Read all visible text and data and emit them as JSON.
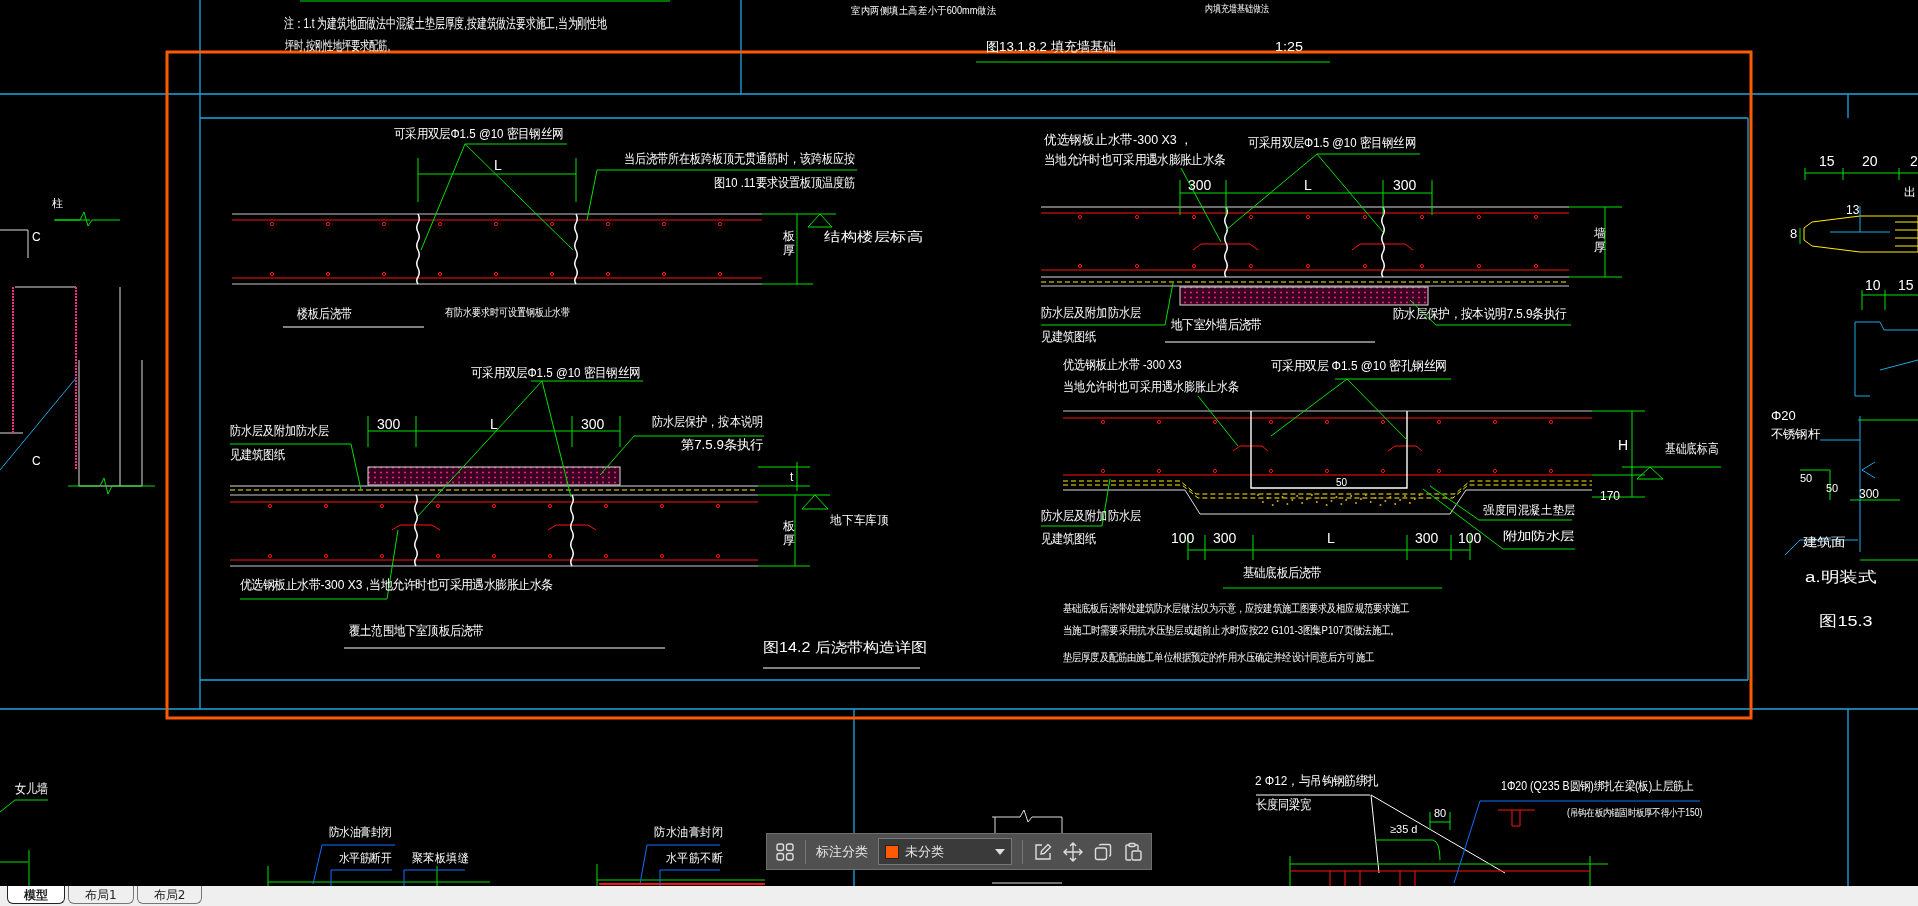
{
  "drawing": {
    "texts": [
      {
        "kind": "note",
        "text": "注：1.t 为建筑地面做法中混凝土垫层厚度,按建筑做法要求施工,当为刚性地"
      },
      {
        "kind": "note",
        "text": "坪时,按刚性地坪要求配筋。"
      },
      {
        "kind": "note",
        "text": "室内两侧填土高差小于600mm做法"
      },
      {
        "kind": "note",
        "text": "内填充墙基础做法"
      },
      {
        "kind": "title",
        "text": "图13.1.8.2  填充墙基础"
      },
      {
        "kind": "title",
        "text": "1:25"
      },
      {
        "kind": "label",
        "text": "可采用双层Φ1.5 @10 密目钢丝网"
      },
      {
        "kind": "dimension",
        "text": "L"
      },
      {
        "kind": "label",
        "text": "当后浇带所在板跨板顶无贯通筋时，该跨板应按"
      },
      {
        "kind": "label",
        "text": "图10 .11要求设置板顶温度筋"
      },
      {
        "kind": "label",
        "text": "结构楼层标高"
      },
      {
        "kind": "vertical",
        "text": "板厚"
      },
      {
        "kind": "title",
        "text": "楼板后浇带"
      },
      {
        "kind": "note",
        "text": "有防水要求时可设置钢板止水带"
      },
      {
        "kind": "label",
        "text": "可采用双层Φ1.5 @10 密目钢丝网"
      },
      {
        "kind": "dimension",
        "text": "300"
      },
      {
        "kind": "dimension",
        "text": "L"
      },
      {
        "kind": "dimension",
        "text": "300"
      },
      {
        "kind": "label",
        "text": "防水层及附加防水层"
      },
      {
        "kind": "label",
        "text": "见建筑图纸"
      },
      {
        "kind": "label",
        "text": "防水层保护，按本说明"
      },
      {
        "kind": "label",
        "text": "第7.5.9条执行"
      },
      {
        "kind": "dimension",
        "text": "t"
      },
      {
        "kind": "vertical",
        "text": "板厚"
      },
      {
        "kind": "label",
        "text": "地下车库顶"
      },
      {
        "kind": "label",
        "text": "优选钢板止水带-300 X3 ,当地允许时也可采用遇水膨胀止水条"
      },
      {
        "kind": "title",
        "text": "覆土范围地下室顶板后浇带"
      },
      {
        "kind": "title",
        "text": "图14.2  后浇带构造详图"
      },
      {
        "kind": "label",
        "text": "优选钢板止水带-300 X3 ，"
      },
      {
        "kind": "label",
        "text": "当地允许时也可采用遇水膨胀止水条"
      },
      {
        "kind": "label",
        "text": "可采用双层Φ1.5 @10 密目钢丝网"
      },
      {
        "kind": "dimension",
        "text": "300"
      },
      {
        "kind": "dimension",
        "text": "L"
      },
      {
        "kind": "dimension",
        "text": "300"
      },
      {
        "kind": "vertical",
        "text": "墙厚"
      },
      {
        "kind": "label",
        "text": "防水层及附加防水层"
      },
      {
        "kind": "title",
        "text": "地下室外墙后浇带"
      },
      {
        "kind": "label",
        "text": "防水层保护，按本说明7.5.9条执行"
      },
      {
        "kind": "label",
        "text": "见建筑图纸"
      },
      {
        "kind": "label",
        "text": "优选钢板止水带 -300 X3"
      },
      {
        "kind": "label",
        "text": "可采用双层  Φ1.5 @10 密孔钢丝网"
      },
      {
        "kind": "label",
        "text": "当地允许时也可采用遇水膨胀止水条"
      },
      {
        "kind": "dimension",
        "text": "H"
      },
      {
        "kind": "label",
        "text": "基础底标高"
      },
      {
        "kind": "dimension",
        "text": "50"
      },
      {
        "kind": "dimension",
        "text": "170"
      },
      {
        "kind": "label",
        "text": "强度同混凝土垫层"
      },
      {
        "kind": "label",
        "text": "防水层及附加防水层"
      },
      {
        "kind": "label",
        "text": "附加防水层"
      },
      {
        "kind": "label",
        "text": "见建筑图纸"
      },
      {
        "kind": "dimension",
        "text": "100"
      },
      {
        "kind": "dimension",
        "text": "300"
      },
      {
        "kind": "dimension",
        "text": "L"
      },
      {
        "kind": "dimension",
        "text": "300"
      },
      {
        "kind": "dimension",
        "text": "100"
      },
      {
        "kind": "title",
        "text": "基础底板后浇带"
      },
      {
        "kind": "note",
        "text": "基础底板后浇带处建筑防水层做法仅为示意，应按建筑施工图要求及相应规范要求施工"
      },
      {
        "kind": "note",
        "text": "当施工时需要采用抗水压垫层或超前止水时应按22 G101-3图集P107页做法施工。"
      },
      {
        "kind": "note",
        "text": "垫层厚度及配筋由施工单位根据预定的作用水压确定并经设计同意后方可施工"
      },
      {
        "kind": "dimension",
        "text": "15"
      },
      {
        "kind": "dimension",
        "text": "20"
      },
      {
        "kind": "dimension",
        "text": "2"
      },
      {
        "kind": "label",
        "text": "出"
      },
      {
        "kind": "dimension",
        "text": "13"
      },
      {
        "kind": "dimension",
        "text": "8"
      },
      {
        "kind": "dimension",
        "text": "10"
      },
      {
        "kind": "dimension",
        "text": "15"
      },
      {
        "kind": "label",
        "text": "Φ20"
      },
      {
        "kind": "label",
        "text": "不锈钢杆"
      },
      {
        "kind": "dimension",
        "text": "50"
      },
      {
        "kind": "dimension",
        "text": "50"
      },
      {
        "kind": "dimension",
        "text": "300"
      },
      {
        "kind": "label",
        "text": "建筑面"
      },
      {
        "kind": "title",
        "text": "a.明装式"
      },
      {
        "kind": "title",
        "text": "图15.3"
      },
      {
        "kind": "label",
        "text": "柱"
      },
      {
        "kind": "label",
        "text": "C"
      },
      {
        "kind": "label",
        "text": "C"
      },
      {
        "kind": "label",
        "text": "女儿墙"
      },
      {
        "kind": "label",
        "text": "防水油膏封闭"
      },
      {
        "kind": "label",
        "text": "水平筋断开"
      },
      {
        "kind": "label",
        "text": "聚苯板填缝"
      },
      {
        "kind": "label",
        "text": "防水油膏封闭"
      },
      {
        "kind": "label",
        "text": "水平筋不断"
      },
      {
        "kind": "label",
        "text": "2 Φ12，与吊钩钢筋绑扎"
      },
      {
        "kind": "label",
        "text": "长度同梁宽"
      },
      {
        "kind": "label",
        "text": "1Φ20 (Q235 B圆钢)绑扎在梁(板)上层筋上"
      },
      {
        "kind": "dimension",
        "text": "80"
      },
      {
        "kind": "note",
        "text": "(吊钩在板内锚固时板厚不得小于150)"
      },
      {
        "kind": "dimension",
        "text": "≥35 d"
      }
    ]
  },
  "toolbar": {
    "label": "标注分类",
    "category": "未分类"
  },
  "tabs": [
    {
      "label": "模型",
      "selected": true
    },
    {
      "label": "布局1",
      "selected": false
    },
    {
      "label": "布局2",
      "selected": false
    }
  ]
}
